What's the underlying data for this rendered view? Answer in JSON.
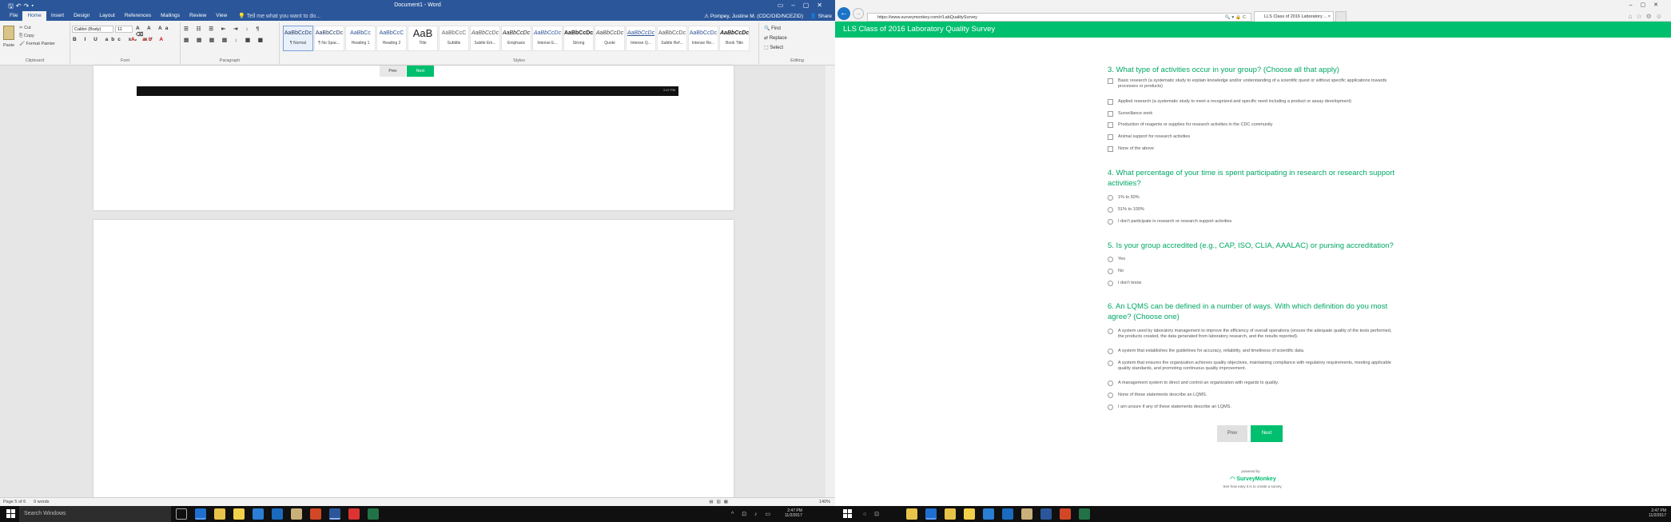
{
  "word": {
    "doc_title": "Document1 - Word",
    "tabs": [
      "File",
      "Home",
      "Insert",
      "Design",
      "Layout",
      "References",
      "Mailings",
      "Review",
      "View"
    ],
    "active_tab": "Home",
    "tell_me": "Tell me what you want to do...",
    "user": "Pompey, Justine M. (CDC/OID/NCEZID)",
    "share": "Share",
    "clipboard": {
      "paste": "Paste",
      "cut": "Cut",
      "copy": "Copy",
      "format_painter": "Format Painter",
      "label": "Clipboard"
    },
    "font": {
      "name": "Calibri (Body)",
      "size": "11",
      "label": "Font",
      "buttons": "B I U abc x₂ x²"
    },
    "paragraph_label": "Paragraph",
    "styles_label": "Styles",
    "styles": [
      {
        "preview": "AaBbCcDc",
        "name": "¶ Normal"
      },
      {
        "preview": "AaBbCcDc",
        "name": "¶ No Spac..."
      },
      {
        "preview": "AaBbCc",
        "name": "Heading 1"
      },
      {
        "preview": "AaBbCcC",
        "name": "Heading 2"
      },
      {
        "preview": "AaB",
        "name": "Title"
      },
      {
        "preview": "AaBbCcC",
        "name": "Subtitle"
      },
      {
        "preview": "AaBbCcDc",
        "name": "Subtle Em..."
      },
      {
        "preview": "AaBbCcDc",
        "name": "Emphasis"
      },
      {
        "preview": "AaBbCcDc",
        "name": "Intense E..."
      },
      {
        "preview": "AaBbCcDc",
        "name": "Strong"
      },
      {
        "preview": "AaBbCcDc",
        "name": "Quote"
      },
      {
        "preview": "AaBbCcDc",
        "name": "Intense Q..."
      },
      {
        "preview": "AaBbCcDc",
        "name": "Subtle Ref..."
      },
      {
        "preview": "AaBbCcDc",
        "name": "Intense Re..."
      },
      {
        "preview": "AaBbCcDc",
        "name": "Book Title"
      }
    ],
    "editing": {
      "find": "Find",
      "replace": "Replace",
      "select": "Select",
      "label": "Editing"
    },
    "embedded": {
      "prev": "Prev",
      "next": "Next",
      "clock": "2:47 PM"
    },
    "status": {
      "page": "Page 5 of 6",
      "words": "0 words",
      "zoom": "140%"
    }
  },
  "ie": {
    "url": "https://www.surveymonkey.com/r/LabQualitySurvey",
    "tab_title": "LLS Class of 2016 Laboratory ...",
    "close_tab": "×"
  },
  "survey": {
    "header": "LLS Class of 2016 Laboratory Quality Survey",
    "questions": [
      {
        "title": "3. What type of activities occur in your group? (Choose all that apply)",
        "type": "checkbox",
        "options": [
          "Basic research (a systematic study to explain knowledge and/or understanding of a scientific quest or without specific applications towards processes or products)",
          "Applied research (a systematic study to meet a recognized and specific need including a product or assay development)",
          "Surveillance work",
          "Production of reagents or supplies for research activities in the CDC community",
          "Animal support for research activities",
          "None of the above"
        ]
      },
      {
        "title": "4. What percentage of your time is spent participating in research or research support activities?",
        "type": "radio",
        "options": [
          "1% to 50%",
          "51% to 100%",
          "I don't participate in research or research support activities"
        ]
      },
      {
        "title": "5. Is your group accredited (e.g., CAP, ISO, CLIA, AAALAC) or pursing accreditation?",
        "type": "radio",
        "options": [
          "Yes",
          "No",
          "I don't know"
        ]
      },
      {
        "title": "6. An LQMS can be defined in a number of ways. With which definition do you most agree? (Choose one)",
        "type": "radio",
        "options": [
          "A system used by laboratory management to improve the efficiency of overall operations (ensure the adequate quality of the tests performed, the products created, the data generated from laboratory research, and the results reported).",
          "A system that establishes the guidelines for accuracy, reliability, and timeliness of scientific data.",
          "A system that ensures the organization achieves quality objectives, maintaining compliance with regulatory requirements, meeting applicable quality standards, and promoting continuous quality improvement.",
          "A management system to direct and control an organization with regards to quality.",
          "None of these statements describe an LQMS.",
          "I am unsure if any of these statements describe an LQMS."
        ]
      }
    ],
    "prev": "Prev",
    "next": "Next",
    "powered_by": "powered by",
    "brand": "SurveyMonkey",
    "brand_sub": "See how easy it is to create a survey."
  },
  "taskbar": {
    "search": "Search Windows",
    "time": "2:47 PM",
    "date": "11/2/2017"
  },
  "colors": {
    "word_blue": "#2b579a",
    "survey_green": "#00bf6f",
    "question_green": "#00a865"
  }
}
